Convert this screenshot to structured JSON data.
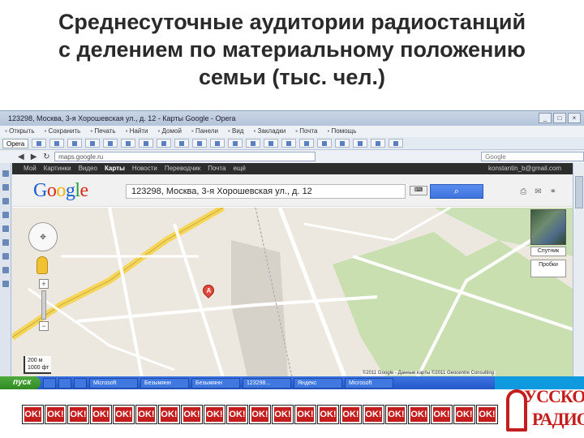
{
  "slide": {
    "title_lines": [
      "Среднесуточные аудитории радиостанций",
      "с делением по материальному положению",
      "семьи (тыс. чел.)"
    ]
  },
  "browser": {
    "window_title": "123298, Москва, 3-я Хорошевская ул., д. 12 - Карты Google - Opera",
    "win_ctrls": [
      "_",
      "□",
      "×"
    ],
    "menu": [
      "Открыть",
      "Сохранить",
      "Печать",
      "Найти",
      "Домой",
      "Панели",
      "Вид",
      "Закладки",
      "Почта",
      "Помощь"
    ],
    "first_tab": "Opera",
    "url": "maps.google.ru",
    "search_placeholder": "Google",
    "nav": {
      "back": "◀",
      "forward": "▶",
      "reload": "↻"
    }
  },
  "google": {
    "nav_items": [
      "Мой",
      "Картинки",
      "Видео",
      "Карты",
      "Новости",
      "Переводчик",
      "Почта",
      "ещё"
    ],
    "active_nav": "Карты",
    "account": "konstantin_b@gmail.com",
    "logo_letters": [
      "G",
      "o",
      "o",
      "g",
      "l",
      "e"
    ],
    "logo_colors": [
      "#1a5fd1",
      "#d62d20",
      "#f4b400",
      "#1a5fd1",
      "#26a23a",
      "#d62d20"
    ],
    "search_value": "123298, Москва, 3-я Хорошевская ул., д. 12",
    "keyboard_label": "⌨",
    "search_button": "",
    "tools": [
      "⎙",
      "✉",
      "⚭"
    ]
  },
  "map": {
    "pan_label": "✥",
    "pin_letter": "A",
    "zoom_in": "+",
    "zoom_out": "−",
    "scale_lines": [
      "200 м",
      "1000 фт"
    ],
    "copyright": "©2011 Google - Данные карты ©2011 Geocentre Consulting",
    "satellite_label": "Спутник",
    "traffic_label": "Пробки"
  },
  "taskbar": {
    "start_label": "пуск",
    "tasks": [
      "Microsoft",
      "Безымянн",
      "Безымянн",
      "123298...",
      "Яндекс",
      "Microsoft"
    ]
  },
  "strip": {
    "ok_label": "OK!",
    "ok_count": 21
  },
  "logo": {
    "line1": "УССКОЕ",
    "line2": "РАДИО"
  }
}
